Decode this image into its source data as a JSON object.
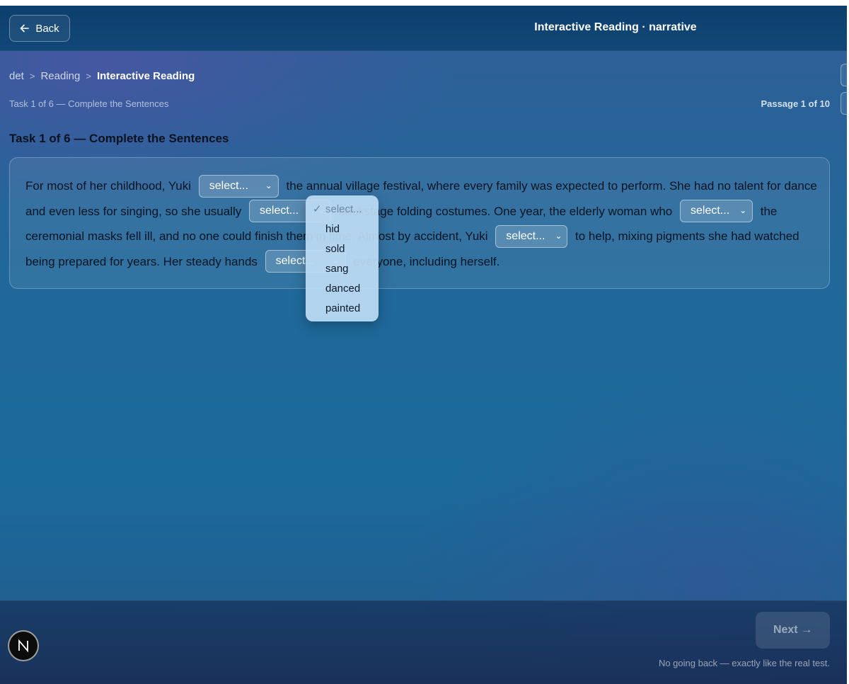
{
  "topbar": {
    "back_label": "Back",
    "title": "Interactive Reading · narrative"
  },
  "breadcrumb": {
    "items": [
      "det",
      "Reading",
      "Interactive Reading"
    ],
    "separator": ">"
  },
  "subtitle": "Task 1 of 6 — Complete the Sentences",
  "passage_counter": "Passage 1 of 10",
  "task_title": "Task 1 of 6 — Complete the Sentences",
  "paragraph": {
    "s1": "For most of her childhood, Yuki",
    "s2": "the annual village festival, where every family was expected to perform. She had no talent for dance and even less for singing, so she usually",
    "s3": "backstage folding costumes. One year, the elderly woman who",
    "s4": "the ceremonial masks fell ill, and no one could finish them in time. Almost by accident, Yuki",
    "s5": "to help, mixing pigments she had watched being prepared for years. Her steady hands",
    "s6": "everyone, including herself.",
    "select_placeholder": "select..."
  },
  "dropdown": {
    "options": [
      "select...",
      "hid",
      "sold",
      "sang",
      "danced",
      "painted"
    ],
    "selected_index": 0
  },
  "footer": {
    "next_label": "Next →",
    "hint": "No going back — exactly like the real test."
  },
  "badge": {
    "letter": "N"
  },
  "colors": {
    "topbar": "#0e3f6c",
    "background": "#1a6a9b",
    "text_dark": "#0b1422"
  }
}
